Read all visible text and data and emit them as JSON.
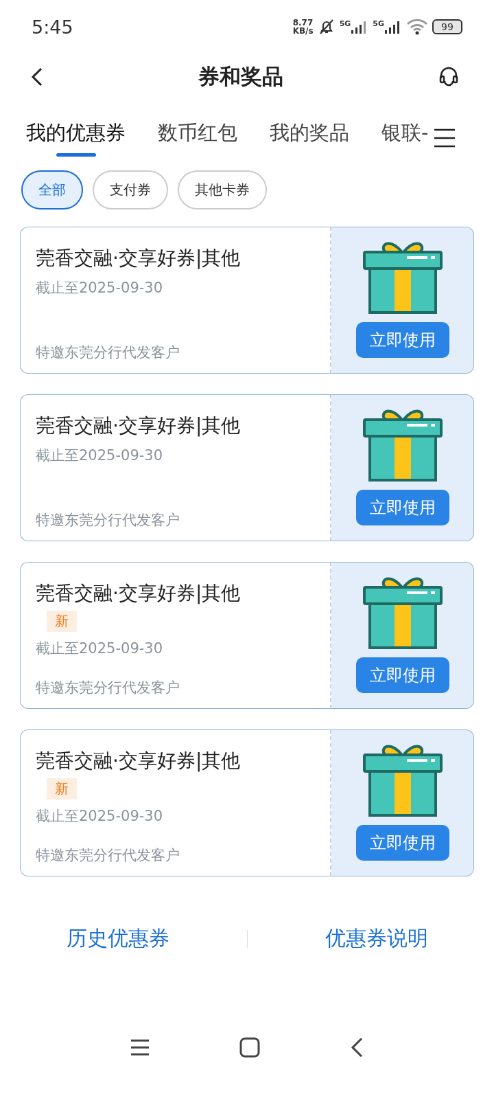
{
  "status_bar": {
    "time": "5:45",
    "speed_value": "8.77",
    "speed_unit": "KB/s",
    "network_1": "5G",
    "network_2": "5G",
    "battery": "99"
  },
  "header": {
    "title": "券和奖品"
  },
  "tabs": [
    {
      "label": "我的优惠券",
      "selected": true
    },
    {
      "label": "数币红包",
      "selected": false
    },
    {
      "label": "我的奖品",
      "selected": false
    },
    {
      "label": "银联-",
      "selected": false
    }
  ],
  "filters": [
    {
      "label": "全部",
      "selected": true
    },
    {
      "label": "支付券",
      "selected": false
    },
    {
      "label": "其他卡券",
      "selected": false
    }
  ],
  "coupons": [
    {
      "title": "莞香交融·交享好券|其他",
      "expiry": "截止至2025-09-30",
      "audience": "特邀东莞分行代发客户",
      "button": "立即使用"
    },
    {
      "title": "莞香交融·交享好券|其他",
      "expiry": "截止至2025-09-30",
      "audience": "特邀东莞分行代发客户",
      "button": "立即使用"
    },
    {
      "title": "莞香交融·交享好券|其他",
      "badge": "新",
      "expiry": "截止至2025-09-30",
      "audience": "特邀东莞分行代发客户",
      "button": "立即使用"
    },
    {
      "title": "莞香交融·交享好券|其他",
      "badge": "新",
      "expiry": "截止至2025-09-30",
      "audience": "特邀东莞分行代发客户",
      "button": "立即使用"
    }
  ],
  "footer_links": [
    "历史优惠券",
    "优惠券说明"
  ]
}
